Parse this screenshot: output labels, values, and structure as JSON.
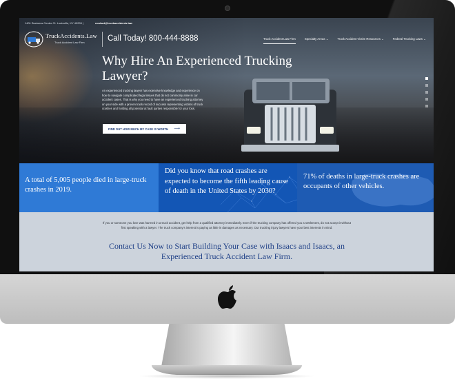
{
  "topbar": {
    "address": "1401 Business Center Ct. Louisville, KY 40299 |",
    "email": "contact@truckaccidents.law"
  },
  "logo": {
    "name": "TruckAccidents.Law",
    "tagline": "Truck Accident Law Firm"
  },
  "phone": "Call Today! 800-444-8888",
  "nav": {
    "items": [
      {
        "label": "Truck Accident Law Firm"
      },
      {
        "label": "Specialty Areas ⌄"
      },
      {
        "label": "Truck Accident Victim Resources ⌄"
      },
      {
        "label": "Federal Trucking Laws ⌄"
      }
    ]
  },
  "hero": {
    "headline": "Why Hire An Experienced Trucking Lawyer?",
    "body": "An experienced trucking lawyer has extensive knowledge and experience on how to navigate complicated legal issues that do not commonly arise in car accident cases. That is why you need to have an experienced trucking attorney on your side with a proven track record of success representing victims of truck crashes and holding all potential at fault parties responsible for your loss.",
    "cta_label": "FIND OUT HOW MUCH MY CASE IS WORTH",
    "cta_arrow": "⟶"
  },
  "stats": [
    {
      "text": "A total of 5,005 people died in large-truck crashes in 2019."
    },
    {
      "text": "Did you know that road crashes are expected to become the fifth leading cause of death in the United States by 2030?"
    },
    {
      "text": "71% of deaths in large-truck crashes are occupants of other vehicles."
    }
  ],
  "lower": {
    "text": "If you or someone you love was harmed in a truck accident, get help from a qualified attorney immediately. Even if the trucking company has offered you a settlement, do not accept it without first speaking with a lawyer. The truck company's interest is paying as little in damages as necessary. Our trucking injury lawyers have your best interests in mind.",
    "heading": "Contact Us Now to Start Building Your Case with Isaacs and Isaacs, an Experienced Truck Accident Law Firm."
  },
  "colors": {
    "stat1": "#2f7ad6",
    "stat2": "#1356b5",
    "stat3": "#1e5bb3",
    "lower_bg": "#ccd3dc",
    "heading": "#1e3f86"
  },
  "icons": [
    "apple-logo-icon",
    "truck-logo-icon",
    "arrow-right-icon"
  ]
}
